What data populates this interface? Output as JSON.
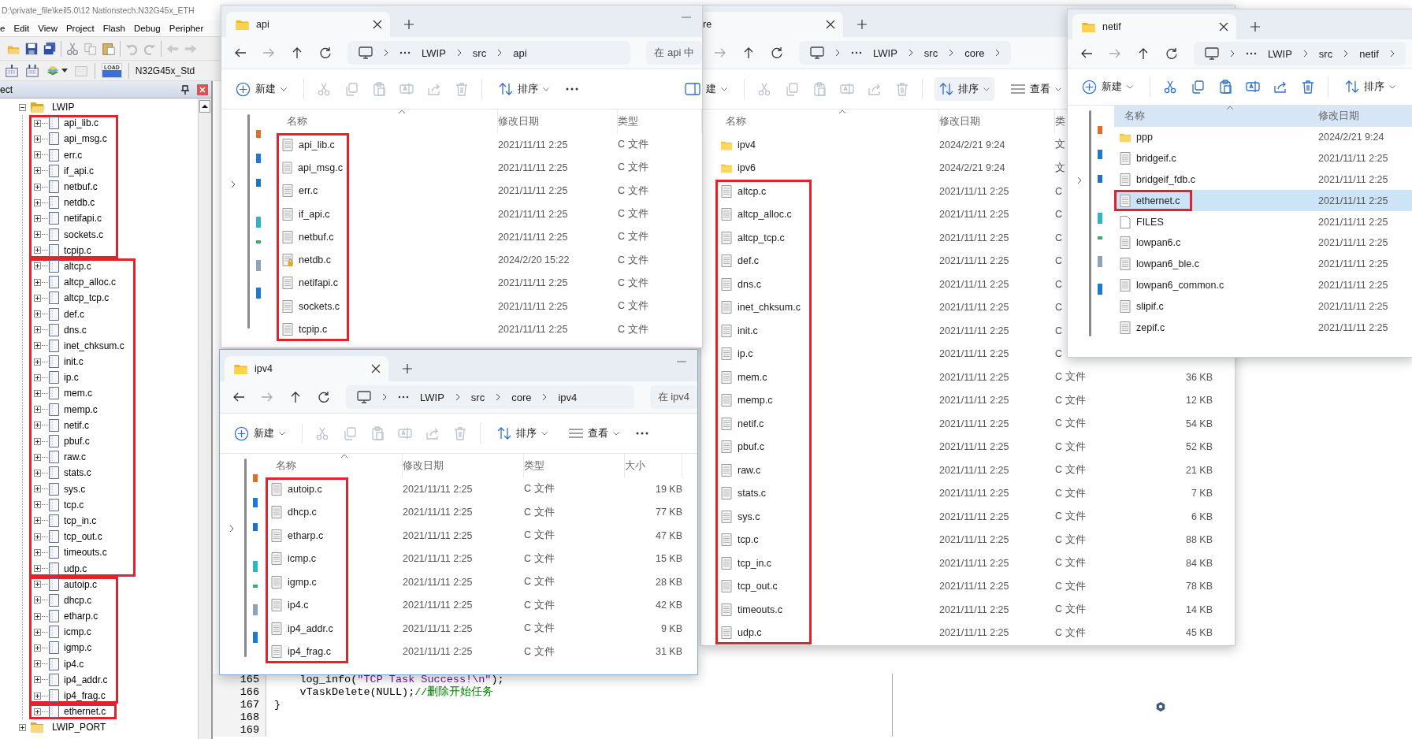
{
  "ide": {
    "title": "D:\\private_file\\keil5.0\\12 Nationstech.N32G45x_ETH",
    "menu": [
      "e",
      "Edit",
      "View",
      "Project",
      "Flash",
      "Debug",
      "Peripher"
    ],
    "toolbar": {
      "load_label": "LOAD",
      "target": "N32G45x_Std"
    },
    "project_panel": {
      "title": "ect",
      "tree": [
        {
          "label": "LWIP",
          "kind": "folder",
          "expanded": true,
          "children": [
            {
              "kind": "group",
              "boxed": true,
              "children": [
                {
                  "label": "api_lib.c",
                  "kind": "file",
                  "expanded": false
                },
                {
                  "label": "api_msg.c",
                  "kind": "file",
                  "expanded": false
                },
                {
                  "label": "err.c",
                  "kind": "file",
                  "expanded": false
                },
                {
                  "label": "if_api.c",
                  "kind": "file",
                  "expanded": false
                },
                {
                  "label": "netbuf.c",
                  "kind": "file",
                  "expanded": false
                },
                {
                  "label": "netdb.c",
                  "kind": "file",
                  "expanded": false
                },
                {
                  "label": "netifapi.c",
                  "kind": "file",
                  "expanded": false
                },
                {
                  "label": "sockets.c",
                  "kind": "file",
                  "expanded": false
                },
                {
                  "label": "tcpip.c",
                  "kind": "file",
                  "expanded": false
                }
              ]
            },
            {
              "kind": "group",
              "boxed": true,
              "children": [
                {
                  "label": "altcp.c",
                  "kind": "file",
                  "expanded": false
                },
                {
                  "label": "altcp_alloc.c",
                  "kind": "file",
                  "expanded": false
                },
                {
                  "label": "altcp_tcp.c",
                  "kind": "file",
                  "expanded": false
                },
                {
                  "label": "def.c",
                  "kind": "file",
                  "expanded": false
                },
                {
                  "label": "dns.c",
                  "kind": "file",
                  "expanded": false
                },
                {
                  "label": "inet_chksum.c",
                  "kind": "file",
                  "expanded": false
                },
                {
                  "label": "init.c",
                  "kind": "file",
                  "expanded": false
                },
                {
                  "label": "ip.c",
                  "kind": "file",
                  "expanded": false
                },
                {
                  "label": "mem.c",
                  "kind": "file",
                  "expanded": false
                },
                {
                  "label": "memp.c",
                  "kind": "file",
                  "expanded": false
                },
                {
                  "label": "netif.c",
                  "kind": "file",
                  "expanded": false
                },
                {
                  "label": "pbuf.c",
                  "kind": "file",
                  "expanded": false
                },
                {
                  "label": "raw.c",
                  "kind": "file",
                  "expanded": false
                },
                {
                  "label": "stats.c",
                  "kind": "file",
                  "expanded": false
                },
                {
                  "label": "sys.c",
                  "kind": "file",
                  "expanded": false
                },
                {
                  "label": "tcp.c",
                  "kind": "file",
                  "expanded": false
                },
                {
                  "label": "tcp_in.c",
                  "kind": "file",
                  "expanded": false
                },
                {
                  "label": "tcp_out.c",
                  "kind": "file",
                  "expanded": false
                },
                {
                  "label": "timeouts.c",
                  "kind": "file",
                  "expanded": false
                },
                {
                  "label": "udp.c",
                  "kind": "file",
                  "expanded": false
                }
              ]
            },
            {
              "kind": "group",
              "boxed": true,
              "children": [
                {
                  "label": "autoip.c",
                  "kind": "file",
                  "expanded": false
                },
                {
                  "label": "dhcp.c",
                  "kind": "file",
                  "expanded": false
                },
                {
                  "label": "etharp.c",
                  "kind": "file",
                  "expanded": false
                },
                {
                  "label": "icmp.c",
                  "kind": "file",
                  "expanded": false
                },
                {
                  "label": "igmp.c",
                  "kind": "file",
                  "expanded": false
                },
                {
                  "label": "ip4.c",
                  "kind": "file",
                  "expanded": false
                },
                {
                  "label": "ip4_addr.c",
                  "kind": "file",
                  "expanded": false
                },
                {
                  "label": "ip4_frag.c",
                  "kind": "file",
                  "expanded": false
                }
              ]
            },
            {
              "kind": "group",
              "boxed": true,
              "children": [
                {
                  "label": "ethernet.c",
                  "kind": "file",
                  "expanded": false
                }
              ]
            }
          ]
        },
        {
          "label": "LWIP_PORT",
          "kind": "folder",
          "expanded": false
        }
      ]
    },
    "editor": {
      "lines": [
        {
          "number": "165",
          "segments": [
            {
              "kind": "plain",
              "text": "    log_info("
            },
            {
              "kind": "string",
              "text": "\"TCP Task Success!\\n\""
            },
            {
              "kind": "plain",
              "text": ");"
            }
          ]
        },
        {
          "number": "166",
          "segments": [
            {
              "kind": "plain",
              "text": "    vTaskDelete(NULL);"
            },
            {
              "kind": "comment",
              "text": "//删除开始任务"
            }
          ]
        },
        {
          "number": "167",
          "segments": [
            {
              "kind": "plain",
              "text": "}"
            }
          ]
        },
        {
          "number": "168"
        },
        {
          "number": "169"
        }
      ]
    }
  },
  "windows": [
    {
      "title": "api",
      "clipped_left": false,
      "breadcrumb": [
        "LWIP",
        "src",
        "api"
      ],
      "trailing_chevron": false,
      "search": {
        "placeholder": "在 api 中"
      },
      "toolbar": {
        "new_label": "新建",
        "sort_label": "排序",
        "actions_enabled": false
      },
      "columns": [
        "名称",
        "修改日期",
        "类型"
      ],
      "groups": [
        {
          "boxed": true,
          "rows": [
            {
              "name": "api_lib.c",
              "kind": "c_file",
              "date": "2021/11/11 2:25",
              "type": "C 文件",
              "selected": false
            },
            {
              "name": "api_msg.c",
              "kind": "c_file",
              "date": "2021/11/11 2:25",
              "type": "C 文件",
              "selected": false
            },
            {
              "name": "err.c",
              "kind": "c_file",
              "date": "2021/11/11 2:25",
              "type": "C 文件",
              "selected": false
            },
            {
              "name": "if_api.c",
              "kind": "c_file",
              "date": "2021/11/11 2:25",
              "type": "C 文件",
              "selected": false
            },
            {
              "name": "netbuf.c",
              "kind": "c_file",
              "date": "2021/11/11 2:25",
              "type": "C 文件",
              "selected": false
            },
            {
              "name": "netdb.c",
              "kind": "locked_c_file",
              "date": "2024/2/20 15:22",
              "type": "C 文件",
              "selected": false
            },
            {
              "name": "netifapi.c",
              "kind": "c_file",
              "date": "2021/11/11 2:25",
              "type": "C 文件",
              "selected": false
            },
            {
              "name": "sockets.c",
              "kind": "c_file",
              "date": "2021/11/11 2:25",
              "type": "C 文件",
              "selected": false
            },
            {
              "name": "tcpip.c",
              "kind": "c_file",
              "date": "2021/11/11 2:25",
              "type": "C 文件",
              "selected": false
            }
          ]
        }
      ]
    },
    {
      "title": "re",
      "clipped_left": true,
      "breadcrumb": [
        "LWIP",
        "src",
        "core"
      ],
      "trailing_chevron": true,
      "toolbar": {
        "new_label": "建",
        "sort_label": "排序",
        "view_label": "查看",
        "actions_enabled": false
      },
      "columns": [
        "名称",
        "修改日期",
        "类"
      ],
      "groups": [
        {
          "boxed": false,
          "rows": [
            {
              "name": "ipv4",
              "kind": "folder",
              "date": "2024/2/21 9:24",
              "type": "文",
              "selected": false
            },
            {
              "name": "ipv6",
              "kind": "folder",
              "date": "2024/2/21 9:24",
              "type": "文",
              "selected": false
            }
          ]
        },
        {
          "boxed": true,
          "rows": [
            {
              "name": "altcp.c",
              "kind": "c_file",
              "date": "2021/11/11 2:25",
              "type": "C",
              "selected": false
            },
            {
              "name": "altcp_alloc.c",
              "kind": "c_file",
              "date": "2021/11/11 2:25",
              "type": "C",
              "selected": false
            },
            {
              "name": "altcp_tcp.c",
              "kind": "c_file",
              "date": "2021/11/11 2:25",
              "type": "C",
              "selected": false
            },
            {
              "name": "def.c",
              "kind": "c_file",
              "date": "2021/11/11 2:25",
              "type": "C",
              "selected": false
            },
            {
              "name": "dns.c",
              "kind": "c_file",
              "date": "2021/11/11 2:25",
              "type": "C",
              "selected": false
            },
            {
              "name": "inet_chksum.c",
              "kind": "c_file",
              "date": "2021/11/11 2:25",
              "type": "C",
              "selected": false
            },
            {
              "name": "init.c",
              "kind": "c_file",
              "date": "2021/11/11 2:25",
              "type": "C",
              "selected": false
            },
            {
              "name": "ip.c",
              "kind": "c_file",
              "date": "2021/11/11 2:25",
              "type": "C",
              "selected": false
            },
            {
              "name": "mem.c",
              "kind": "c_file",
              "date": "2021/11/11 2:25",
              "type": "C 文件",
              "size": "36 KB",
              "selected": false
            },
            {
              "name": "memp.c",
              "kind": "c_file",
              "date": "2021/11/11 2:25",
              "type": "C 文件",
              "size": "12 KB",
              "selected": false
            },
            {
              "name": "netif.c",
              "kind": "c_file",
              "date": "2021/11/11 2:25",
              "type": "C 文件",
              "size": "54 KB",
              "selected": false
            },
            {
              "name": "pbuf.c",
              "kind": "c_file",
              "date": "2021/11/11 2:25",
              "type": "C 文件",
              "size": "52 KB",
              "selected": false
            },
            {
              "name": "raw.c",
              "kind": "c_file",
              "date": "2021/11/11 2:25",
              "type": "C 文件",
              "size": "21 KB",
              "selected": false
            },
            {
              "name": "stats.c",
              "kind": "c_file",
              "date": "2021/11/11 2:25",
              "type": "C 文件",
              "size": "7 KB",
              "selected": false
            },
            {
              "name": "sys.c",
              "kind": "c_file",
              "date": "2021/11/11 2:25",
              "type": "C 文件",
              "size": "6 KB",
              "selected": false
            },
            {
              "name": "tcp.c",
              "kind": "c_file",
              "date": "2021/11/11 2:25",
              "type": "C 文件",
              "size": "88 KB",
              "selected": false
            },
            {
              "name": "tcp_in.c",
              "kind": "c_file",
              "date": "2021/11/11 2:25",
              "type": "C 文件",
              "size": "84 KB",
              "selected": false
            },
            {
              "name": "tcp_out.c",
              "kind": "c_file",
              "date": "2021/11/11 2:25",
              "type": "C 文件",
              "size": "78 KB",
              "selected": false
            },
            {
              "name": "timeouts.c",
              "kind": "c_file",
              "date": "2021/11/11 2:25",
              "type": "C 文件",
              "size": "14 KB",
              "selected": false
            },
            {
              "name": "udp.c",
              "kind": "c_file",
              "date": "2021/11/11 2:25",
              "type": "C 文件",
              "size": "45 KB",
              "selected": false
            }
          ]
        }
      ]
    },
    {
      "title": "netif",
      "clipped_left": false,
      "breadcrumb": [
        "LWIP",
        "src",
        "netif"
      ],
      "trailing_chevron": true,
      "toolbar": {
        "new_label": "新建",
        "sort_label": "排序",
        "actions_enabled": true
      },
      "columns": [
        "名称",
        "修改日期"
      ],
      "groups": [
        {
          "boxed": false,
          "rows": [
            {
              "name": "ppp",
              "kind": "folder",
              "date": "2024/2/21 9:24",
              "selected": false
            },
            {
              "name": "bridgeif.c",
              "kind": "c_file",
              "date": "2021/11/11 2:25",
              "selected": false
            },
            {
              "name": "bridgeif_fdb.c",
              "kind": "c_file",
              "date": "2021/11/11 2:25",
              "selected": false
            }
          ]
        },
        {
          "boxed": true,
          "rows": [
            {
              "name": "ethernet.c",
              "kind": "c_file",
              "date": "2021/11/11 2:25",
              "selected": true
            }
          ]
        },
        {
          "boxed": false,
          "rows": [
            {
              "name": "FILES",
              "kind": "plain_file",
              "date": "2021/11/11 2:25",
              "selected": false
            },
            {
              "name": "lowpan6.c",
              "kind": "c_file",
              "date": "2021/11/11 2:25",
              "selected": false
            },
            {
              "name": "lowpan6_ble.c",
              "kind": "c_file",
              "date": "2021/11/11 2:25",
              "selected": false
            },
            {
              "name": "lowpan6_common.c",
              "kind": "c_file",
              "date": "2021/11/11 2:25",
              "selected": false
            },
            {
              "name": "slipif.c",
              "kind": "c_file",
              "date": "2021/11/11 2:25",
              "selected": false
            },
            {
              "name": "zepif.c",
              "kind": "c_file",
              "date": "2021/11/11 2:25",
              "selected": false
            }
          ]
        }
      ]
    },
    {
      "title": "ipv4",
      "clipped_left": false,
      "breadcrumb": [
        "LWIP",
        "src",
        "core",
        "ipv4"
      ],
      "trailing_chevron": false,
      "search": {
        "placeholder": "在 ipv4"
      },
      "toolbar": {
        "new_label": "新建",
        "sort_label": "排序",
        "view_label": "查看",
        "actions_enabled": false
      },
      "columns": [
        "名称",
        "修改日期",
        "类型",
        "大小"
      ],
      "groups": [
        {
          "boxed": true,
          "rows": [
            {
              "name": "autoip.c",
              "kind": "c_file",
              "date": "2021/11/11 2:25",
              "type": "C 文件",
              "size": "19 KB",
              "selected": false
            },
            {
              "name": "dhcp.c",
              "kind": "c_file",
              "date": "2021/11/11 2:25",
              "type": "C 文件",
              "size": "77 KB",
              "selected": false
            },
            {
              "name": "etharp.c",
              "kind": "c_file",
              "date": "2021/11/11 2:25",
              "type": "C 文件",
              "size": "47 KB",
              "selected": false
            },
            {
              "name": "icmp.c",
              "kind": "c_file",
              "date": "2021/11/11 2:25",
              "type": "C 文件",
              "size": "15 KB",
              "selected": false
            },
            {
              "name": "igmp.c",
              "kind": "c_file",
              "date": "2021/11/11 2:25",
              "type": "C 文件",
              "size": "28 KB",
              "selected": false
            },
            {
              "name": "ip4.c",
              "kind": "c_file",
              "date": "2021/11/11 2:25",
              "type": "C 文件",
              "size": "42 KB",
              "selected": false
            },
            {
              "name": "ip4_addr.c",
              "kind": "c_file",
              "date": "2021/11/11 2:25",
              "type": "C 文件",
              "size": "9 KB",
              "selected": false
            },
            {
              "name": "ip4_frag.c",
              "kind": "c_file",
              "date": "2021/11/11 2:25",
              "type": "C 文件",
              "size": "31 KB",
              "selected": false
            }
          ]
        }
      ]
    }
  ]
}
